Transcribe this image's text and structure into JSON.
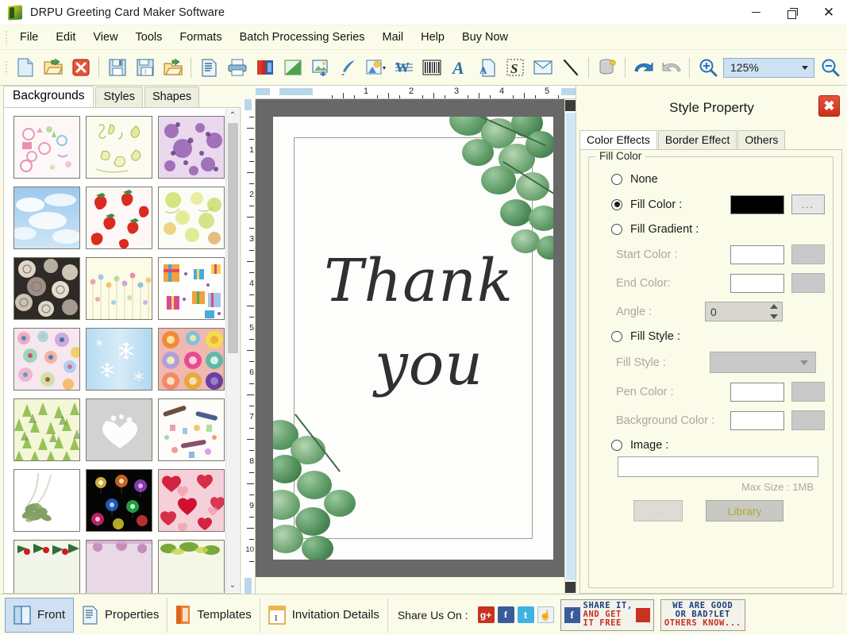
{
  "window": {
    "title": "DRPU Greeting Card Maker Software",
    "minimize": "–",
    "maximize": "❐",
    "close": "✕"
  },
  "menu": {
    "items": [
      {
        "label": "File"
      },
      {
        "label": "Edit"
      },
      {
        "label": "View"
      },
      {
        "label": "Tools"
      },
      {
        "label": "Formats"
      },
      {
        "label": "Batch Processing Series"
      },
      {
        "label": "Mail"
      },
      {
        "label": "Help"
      },
      {
        "label": "Buy Now"
      }
    ]
  },
  "toolbar": {
    "zoom_value": "125%",
    "buttons": [
      {
        "name": "new-document-icon"
      },
      {
        "name": "open-folder-icon"
      },
      {
        "name": "close-document-icon"
      },
      {
        "name": "save-icon"
      },
      {
        "name": "save-as-icon"
      },
      {
        "name": "export-folder-icon"
      },
      {
        "name": "print-preview-icon"
      },
      {
        "name": "print-icon"
      },
      {
        "name": "copy-layers-icon"
      },
      {
        "name": "image-flip-icon"
      },
      {
        "name": "insert-picture-icon"
      },
      {
        "name": "pen-tool-icon"
      },
      {
        "name": "shape-gallery-icon"
      },
      {
        "name": "watermark-icon"
      },
      {
        "name": "barcode-icon"
      },
      {
        "name": "text-tool-icon"
      },
      {
        "name": "text-on-page-icon"
      },
      {
        "name": "signature-icon"
      },
      {
        "name": "envelope-icon"
      },
      {
        "name": "line-tool-icon"
      },
      {
        "name": "database-icon"
      },
      {
        "name": "undo-icon"
      },
      {
        "name": "redo-icon"
      },
      {
        "name": "zoom-in-icon"
      },
      {
        "name": "zoom-out-icon"
      }
    ]
  },
  "left_panel": {
    "tabs": [
      {
        "label": "Backgrounds",
        "active": true
      },
      {
        "label": "Styles",
        "active": false
      },
      {
        "label": "Shapes",
        "active": false
      }
    ],
    "thumbnails": [
      {
        "name": "baby-doodles-background"
      },
      {
        "name": "pears-sketch-background"
      },
      {
        "name": "purple-floral-background"
      },
      {
        "name": "blue-sky-clouds-background"
      },
      {
        "name": "strawberries-background"
      },
      {
        "name": "green-fruit-background"
      },
      {
        "name": "dark-roses-background"
      },
      {
        "name": "pastel-flowers-background"
      },
      {
        "name": "gift-boxes-background"
      },
      {
        "name": "colorful-blooms-background"
      },
      {
        "name": "snowflakes-background"
      },
      {
        "name": "mandala-circles-background"
      },
      {
        "name": "pine-trees-background"
      },
      {
        "name": "white-heart-background"
      },
      {
        "name": "birthday-confetti-background"
      },
      {
        "name": "olive-branch-background"
      },
      {
        "name": "fireworks-background"
      },
      {
        "name": "red-hearts-background"
      },
      {
        "name": "holly-berries-background"
      },
      {
        "name": "pink-texture-background"
      },
      {
        "name": "green-leaves-background"
      }
    ],
    "scroll_up": "⌃",
    "scroll_down": "⌄"
  },
  "canvas": {
    "ruler_h_numbers": [
      "1",
      "2",
      "3",
      "4",
      "5"
    ],
    "ruler_v_numbers": [
      "1",
      "2",
      "3",
      "4",
      "5",
      "6",
      "7",
      "8",
      "9",
      "10"
    ],
    "card": {
      "line1": "Thank",
      "line2": "you"
    }
  },
  "style_property": {
    "title": "Style Property",
    "close": "✖",
    "tabs": [
      {
        "label": "Color Effects",
        "active": true
      },
      {
        "label": "Border Effect",
        "active": false
      },
      {
        "label": "Others",
        "active": false
      }
    ],
    "group_legend": "Fill Color",
    "options": {
      "none": "None",
      "fill_color": "Fill Color :",
      "fill_gradient": "Fill Gradient :",
      "fill_style": "Fill Style :",
      "image": "Image :"
    },
    "fields": {
      "start_color": "Start Color :",
      "end_color": "End Color:",
      "angle": "Angle :",
      "angle_value": "0",
      "fill_style": "Fill Style :",
      "pen_color": "Pen Color :",
      "background_color": "Background Color :",
      "image_path": "",
      "max_size": "Max Size : 1MB"
    },
    "colors": {
      "fill_color_swatch": "#000000",
      "start_color_swatch": "#ffffff",
      "end_color_swatch": "#ffffff",
      "pen_color_swatch": "#ffffff",
      "background_color_swatch": "#ffffff"
    },
    "buttons": {
      "browse": "...",
      "library": "Library",
      "dots": "..."
    }
  },
  "bottom_bar": {
    "items": [
      {
        "label": "Front",
        "icon": "front-card-icon",
        "active": true
      },
      {
        "label": "Properties",
        "icon": "properties-icon",
        "active": false
      },
      {
        "label": "Templates",
        "icon": "templates-icon",
        "active": false
      },
      {
        "label": "Invitation Details",
        "icon": "invitation-details-icon",
        "active": false
      }
    ],
    "share_label": "Share Us On :",
    "social": [
      {
        "name": "google-plus-icon",
        "glyph": "g+"
      },
      {
        "name": "facebook-icon",
        "glyph": "f"
      },
      {
        "name": "twitter-icon",
        "glyph": "t"
      },
      {
        "name": "thumbs-up-icon",
        "glyph": "☝"
      }
    ],
    "banner1": {
      "line1": "SHARE IT,",
      "line2": "AND GET",
      "line3": "IT FREE"
    },
    "banner2": {
      "line1": "WE ARE GOOD",
      "line2": "OR BAD?LET",
      "line3": "OTHERS KNOW..."
    }
  }
}
